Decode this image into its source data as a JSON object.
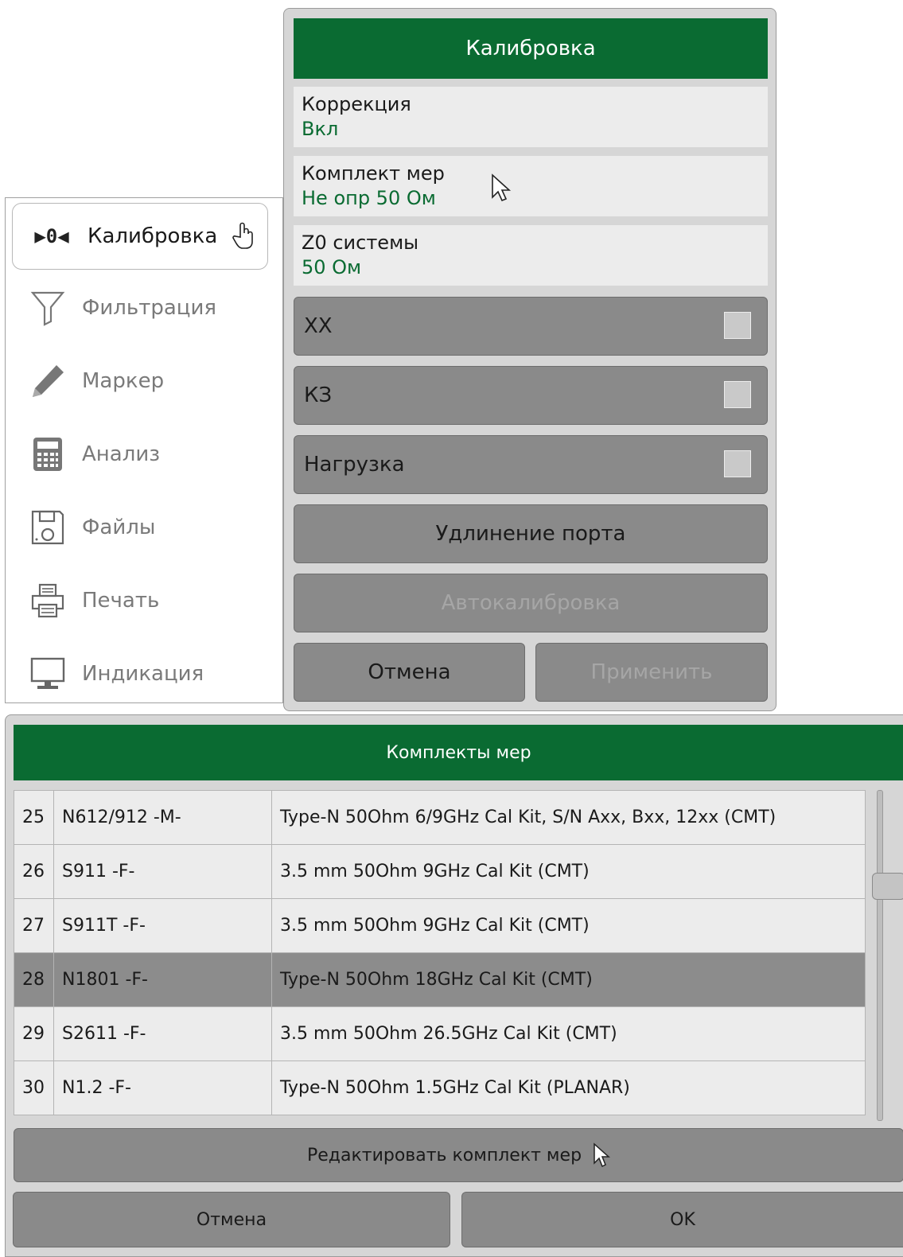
{
  "side_menu": {
    "items": [
      {
        "label": "Калибровка",
        "icon": "calibration-icon",
        "icon_text": "▶0◀",
        "active": true
      },
      {
        "label": "Фильтрация",
        "icon": "filter-icon",
        "active": false
      },
      {
        "label": "Маркер",
        "icon": "pen-marker-icon",
        "active": false
      },
      {
        "label": "Анализ",
        "icon": "calculator-icon",
        "active": false
      },
      {
        "label": "Файлы",
        "icon": "floppy-disk-icon",
        "active": false
      },
      {
        "label": "Печать",
        "icon": "printer-icon",
        "active": false
      },
      {
        "label": "Индикация",
        "icon": "monitor-icon",
        "active": false
      }
    ]
  },
  "calibration_dialog": {
    "title": "Калибровка",
    "correction": {
      "label": "Коррекция",
      "value": "Вкл"
    },
    "cal_kit": {
      "label": "Комплект мер",
      "value": "Не опр 50 Ом"
    },
    "z0": {
      "label": "Z0 системы",
      "value": "50 Ом"
    },
    "open_button": "XX",
    "short_button": "КЗ",
    "load_button": "Нагрузка",
    "port_extension_button": "Удлинение порта",
    "autocal_button": "Автокалибровка",
    "cancel_button": "Отмена",
    "apply_button": "Применить"
  },
  "cal_kit_dialog": {
    "title": "Комплекты мер",
    "rows": [
      {
        "num": "25",
        "name": "N612/912 -M-",
        "description": "Type-N 50Ohm 6/9GHz Cal Kit, S/N Axx, Bxx, 12xx (CMT)",
        "selected": false
      },
      {
        "num": "26",
        "name": "S911 -F-",
        "description": "3.5 mm 50Ohm 9GHz Cal Kit (CMT)",
        "selected": false
      },
      {
        "num": "27",
        "name": "S911T -F-",
        "description": "3.5 mm 50Ohm 9GHz Cal Kit (CMT)",
        "selected": false
      },
      {
        "num": "28",
        "name": "N1801 -F-",
        "description": "Type-N 50Ohm 18GHz Cal Kit (CMT)",
        "selected": true
      },
      {
        "num": "29",
        "name": "S2611 -F-",
        "description": "3.5 mm 50Ohm 26.5GHz Cal Kit (CMT)",
        "selected": false
      },
      {
        "num": "30",
        "name": "N1.2 -F-",
        "description": "Type-N 50Ohm 1.5GHz Cal Kit (PLANAR)",
        "selected": false
      }
    ],
    "edit_button": "Редактировать комплект мер",
    "cancel_button": "Отмена",
    "ok_button": "OK"
  },
  "colors": {
    "title_bar": "#0a6b32",
    "value_text": "#0a6b32",
    "button": "#8a8a8a",
    "selected_row": "#8c8c8c"
  }
}
